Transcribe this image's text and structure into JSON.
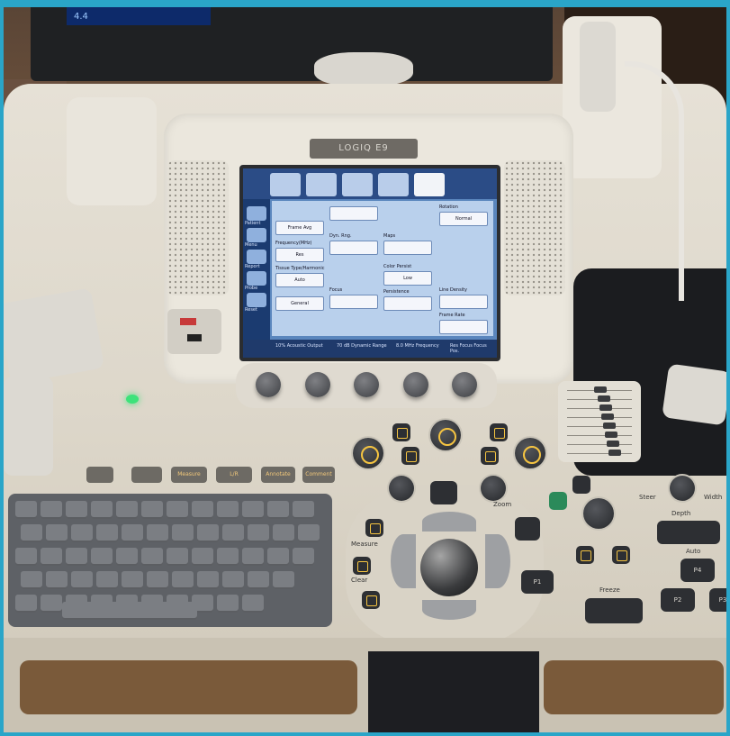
{
  "device": {
    "brand_label": "LOGIQ E9",
    "monitor_readout": "4.4"
  },
  "touchscreen": {
    "tabs": [
      "",
      "",
      "",
      "",
      ""
    ],
    "sidebar": [
      {
        "label": "Patient"
      },
      {
        "label": "Menu"
      },
      {
        "label": "Report"
      },
      {
        "label": "Probe"
      },
      {
        "label": "Reset"
      }
    ],
    "controls": [
      {
        "label": "",
        "value": "Frame Avg"
      },
      {
        "label": "Frequency(MHz)",
        "value": "Res"
      },
      {
        "label": "Tissue Type/Harmonic",
        "value": "Auto"
      },
      {
        "label": "",
        "value": "General"
      },
      {
        "label": "",
        "value": ""
      },
      {
        "label": "Dyn. Rng.",
        "value": ""
      },
      {
        "label": "Focus",
        "value": ""
      },
      {
        "label": "Maps",
        "value": ""
      },
      {
        "label": "Color Persist",
        "value": "Low"
      },
      {
        "label": "Persistence",
        "value": ""
      },
      {
        "label": "Rotation",
        "value": "Normal"
      },
      {
        "label": "Line Density",
        "value": ""
      },
      {
        "label": "Frame Rate",
        "value": ""
      }
    ],
    "status": {
      "item1": "10%\nAcoustic Output",
      "item2": "70 dB\nDynamic Range",
      "item3": "8.0 MHz\nFrequency",
      "item4": "Res Focus\nFocus Pos."
    }
  },
  "keypad": {
    "function_keys": [
      "",
      "",
      "Measure",
      "L/R",
      "Annotate",
      "Comment"
    ],
    "labels": {
      "steer": "Steer",
      "width": "Width",
      "depth": "Depth",
      "auto": "Auto",
      "freeze": "Freeze",
      "p1": "P1",
      "p2": "P2",
      "p3": "P3",
      "p4": "P4",
      "zoom": "Zoom",
      "measure": "Measure",
      "clear": "Clear",
      "comment": "Comment"
    }
  },
  "colors": {
    "screen_bg": "#5a86bd",
    "console_body": "#e6e1d6",
    "accent_key": "#f5c441",
    "power_led": "#3de27a"
  }
}
